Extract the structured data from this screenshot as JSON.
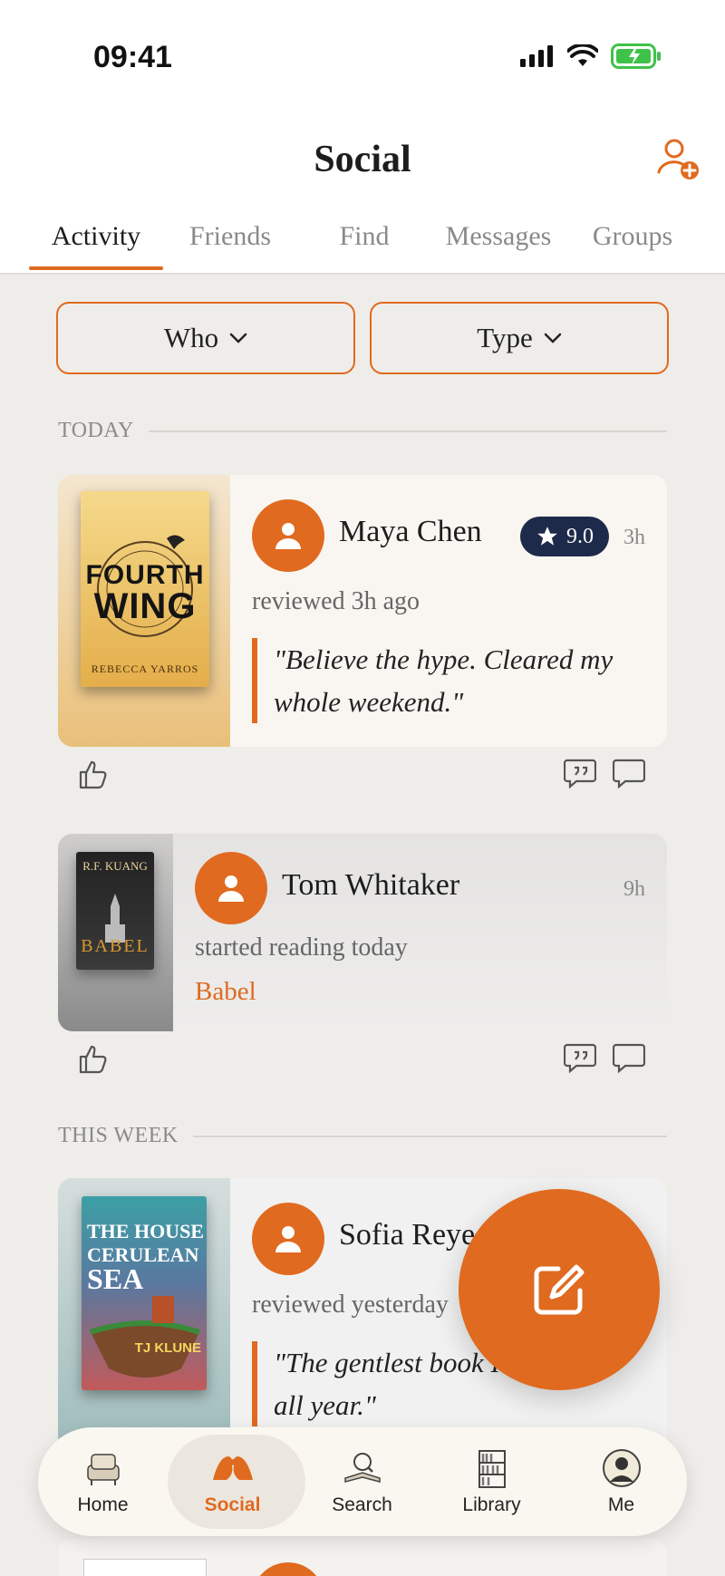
{
  "status_bar": {
    "time": "09:41"
  },
  "header": {
    "title": "Social"
  },
  "tabs": [
    {
      "label": "Activity"
    },
    {
      "label": "Friends"
    },
    {
      "label": "Find"
    },
    {
      "label": "Messages"
    },
    {
      "label": "Groups"
    }
  ],
  "filters": {
    "who": "Who",
    "type": "Type"
  },
  "sections": {
    "today": "TODAY",
    "this_week": "THIS WEEK"
  },
  "feed": [
    {
      "user": "Maya Chen",
      "time": "3h",
      "rating": "9.0",
      "action": "reviewed 3h ago",
      "quote": "\"Believe the hype. Cleared my whole weekend.\"",
      "book": {
        "title_line1": "FOURTH",
        "title_line2": "WING",
        "author": "REBECCA YARROS"
      }
    },
    {
      "user": "Tom Whitaker",
      "time": "9h",
      "action": "started reading today",
      "book_link": "Babel",
      "book": {
        "author": "R.F. KUANG",
        "title": "BABEL"
      }
    },
    {
      "user": "Sofia Reye",
      "action": "reviewed yesterday",
      "quote": "\"The gentlest book I",
      "quote_line2": "all year.\"",
      "book": {
        "title_line1": "THE HOUSE",
        "title_line2": "CERULEAN",
        "title_line3": "SEA",
        "author": "TJ KLUNE"
      }
    }
  ],
  "tab_bar": [
    {
      "label": "Home"
    },
    {
      "label": "Social"
    },
    {
      "label": "Search"
    },
    {
      "label": "Library"
    },
    {
      "label": "Me"
    }
  ],
  "colors": {
    "accent": "#e06a1f",
    "rating_badge": "#1e2a4a",
    "background": "#efedea"
  }
}
